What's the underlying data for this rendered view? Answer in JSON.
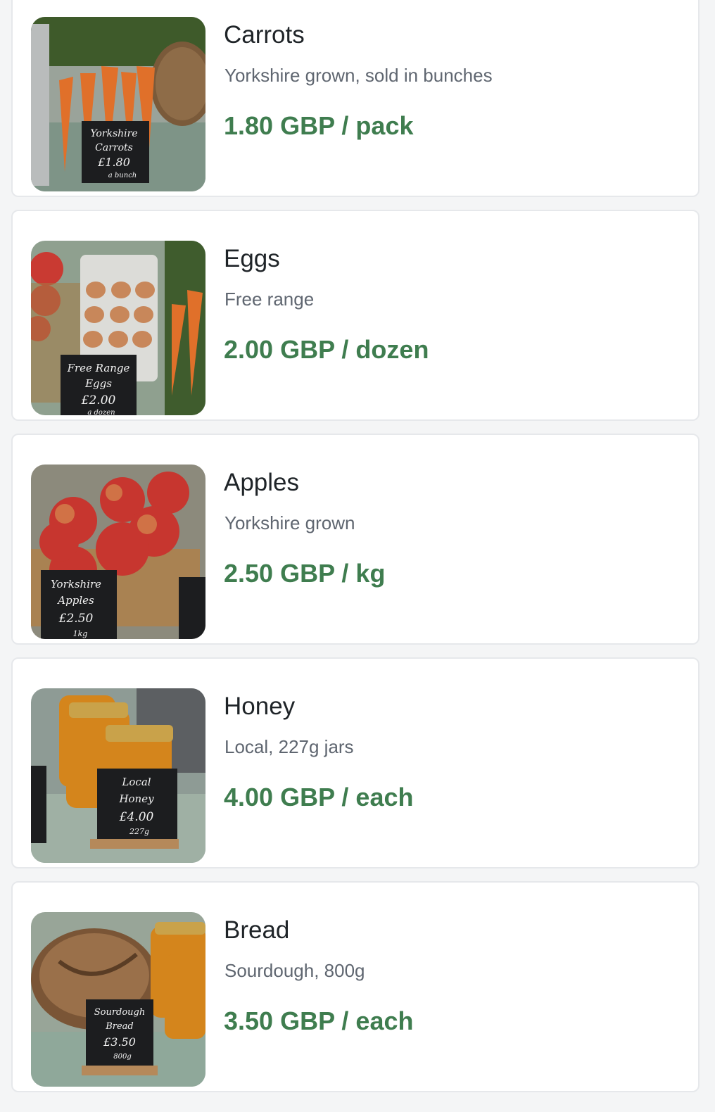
{
  "colors": {
    "price_green": "#3f7d4f",
    "card_border": "#e6e8eb",
    "background": "#f4f5f6"
  },
  "products": [
    {
      "name": "Carrots",
      "description": "Yorkshire grown, sold in bunches",
      "price": "1.80 GBP / pack",
      "sign": [
        "Yorkshire",
        "Carrots",
        "£1.80",
        "a bunch"
      ]
    },
    {
      "name": "Eggs",
      "description": "Free range",
      "price": "2.00 GBP / dozen",
      "sign": [
        "Free Range",
        "Eggs",
        "£2.00",
        "a dozen"
      ]
    },
    {
      "name": "Apples",
      "description": "Yorkshire grown",
      "price": "2.50 GBP / kg",
      "sign": [
        "Yorkshire",
        "Apples",
        "£2.50",
        "1kg"
      ]
    },
    {
      "name": "Honey",
      "description": "Local, 227g jars",
      "price": "4.00 GBP / each",
      "sign": [
        "Local",
        "Honey",
        "£4.00",
        "227g"
      ]
    },
    {
      "name": "Bread",
      "description": "Sourdough, 800g",
      "price": "3.50 GBP / each",
      "sign": [
        "Sourdough",
        "Bread",
        "£3.50",
        "800g"
      ]
    }
  ]
}
